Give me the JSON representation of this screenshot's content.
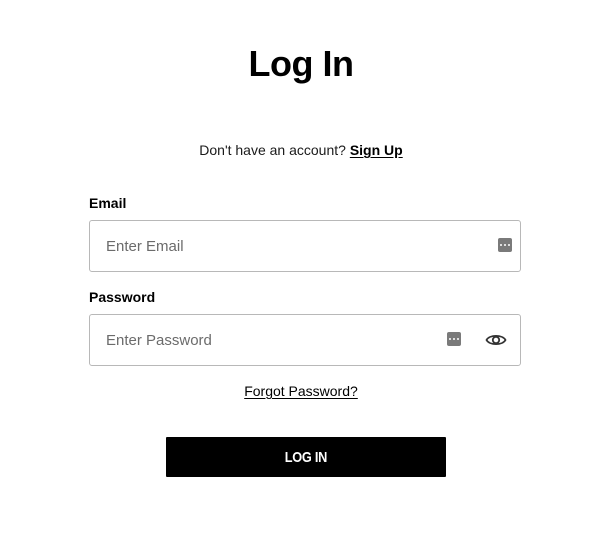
{
  "page": {
    "title": "Log In"
  },
  "signup": {
    "prompt": "Don't have an account?",
    "link_label": "Sign Up"
  },
  "email": {
    "label": "Email",
    "placeholder": "Enter Email",
    "value": ""
  },
  "password": {
    "label": "Password",
    "placeholder": "Enter Password",
    "value": ""
  },
  "icons": {
    "autofill": "password-manager-icon",
    "visibility": "eye-icon"
  },
  "forgot": {
    "label": "Forgot Password?"
  },
  "submit": {
    "label": "LOG IN"
  },
  "colors": {
    "button_bg": "#000000",
    "button_text": "#ffffff",
    "input_border": "#b8b8b8",
    "icon_gray": "#7a7a7a"
  }
}
